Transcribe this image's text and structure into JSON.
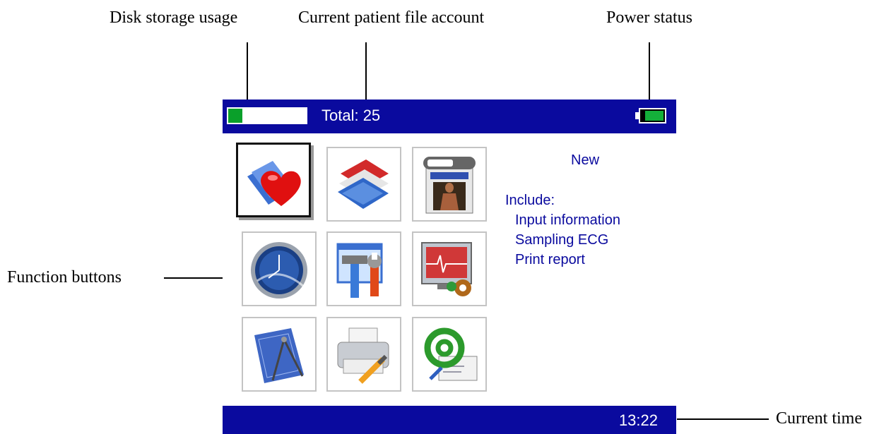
{
  "annotations": {
    "disk": "Disk storage usage",
    "patient": "Current patient file account",
    "power": "Power status",
    "function": "Function buttons",
    "time": "Current time"
  },
  "device": {
    "status_bar": {
      "disk_usage_fraction": 0.18,
      "total_label": "Total: 25",
      "battery_fraction": 0.85
    },
    "buttons": [
      {
        "name": "new-ecg-icon"
      },
      {
        "name": "patient-files-icon"
      },
      {
        "name": "readme-guide-icon"
      },
      {
        "name": "clock-icon"
      },
      {
        "name": "tools-settings-icon"
      },
      {
        "name": "ecg-monitor-settings-icon"
      },
      {
        "name": "blueprint-compass-icon"
      },
      {
        "name": "printer-settings-icon"
      },
      {
        "name": "email-icon"
      }
    ],
    "info_panel": {
      "title": "New",
      "include_label": "Include:",
      "items": [
        "Input information",
        "Sampling ECG",
        "Print report"
      ]
    },
    "clock": "13:22"
  },
  "colors": {
    "bar": "#0a0a9e",
    "accent_green": "#0aa02a",
    "text_blue": "#0a0a9e"
  }
}
